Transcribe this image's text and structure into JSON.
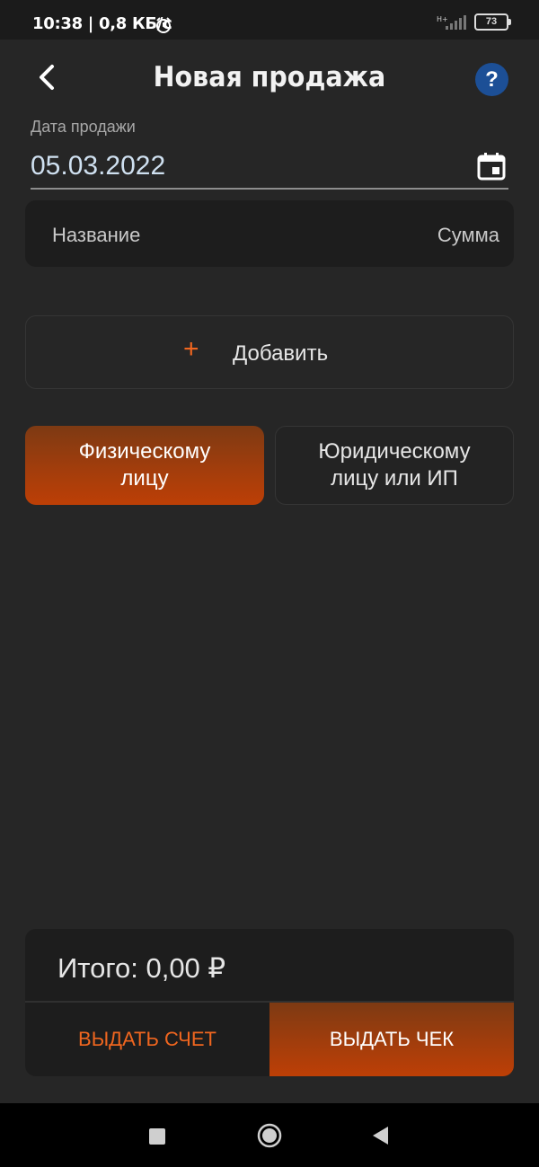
{
  "status_bar": {
    "time": "10:38 | 0,8 КБ/с",
    "battery": "73"
  },
  "header": {
    "title": "Новая продажа",
    "help_label": "?"
  },
  "date_field": {
    "label": "Дата продажи",
    "value": "05.03.2022"
  },
  "table_header": {
    "name_column": "Название",
    "sum_column": "Сумма"
  },
  "add_button": {
    "plus": "+",
    "label": "Добавить"
  },
  "buyer_type": {
    "individual": "Физическому лицу",
    "company": "Юридическому лицу или ИП",
    "selected": "individual"
  },
  "summary": {
    "total": "Итого: 0,00 ₽",
    "invoice_button": "ВЫДАТЬ СЧЕТ",
    "receipt_button": "ВЫДАТЬ ЧЕК"
  },
  "colors": {
    "accent": "#f0661f",
    "help": "#1c4f96",
    "background": "#262626"
  }
}
